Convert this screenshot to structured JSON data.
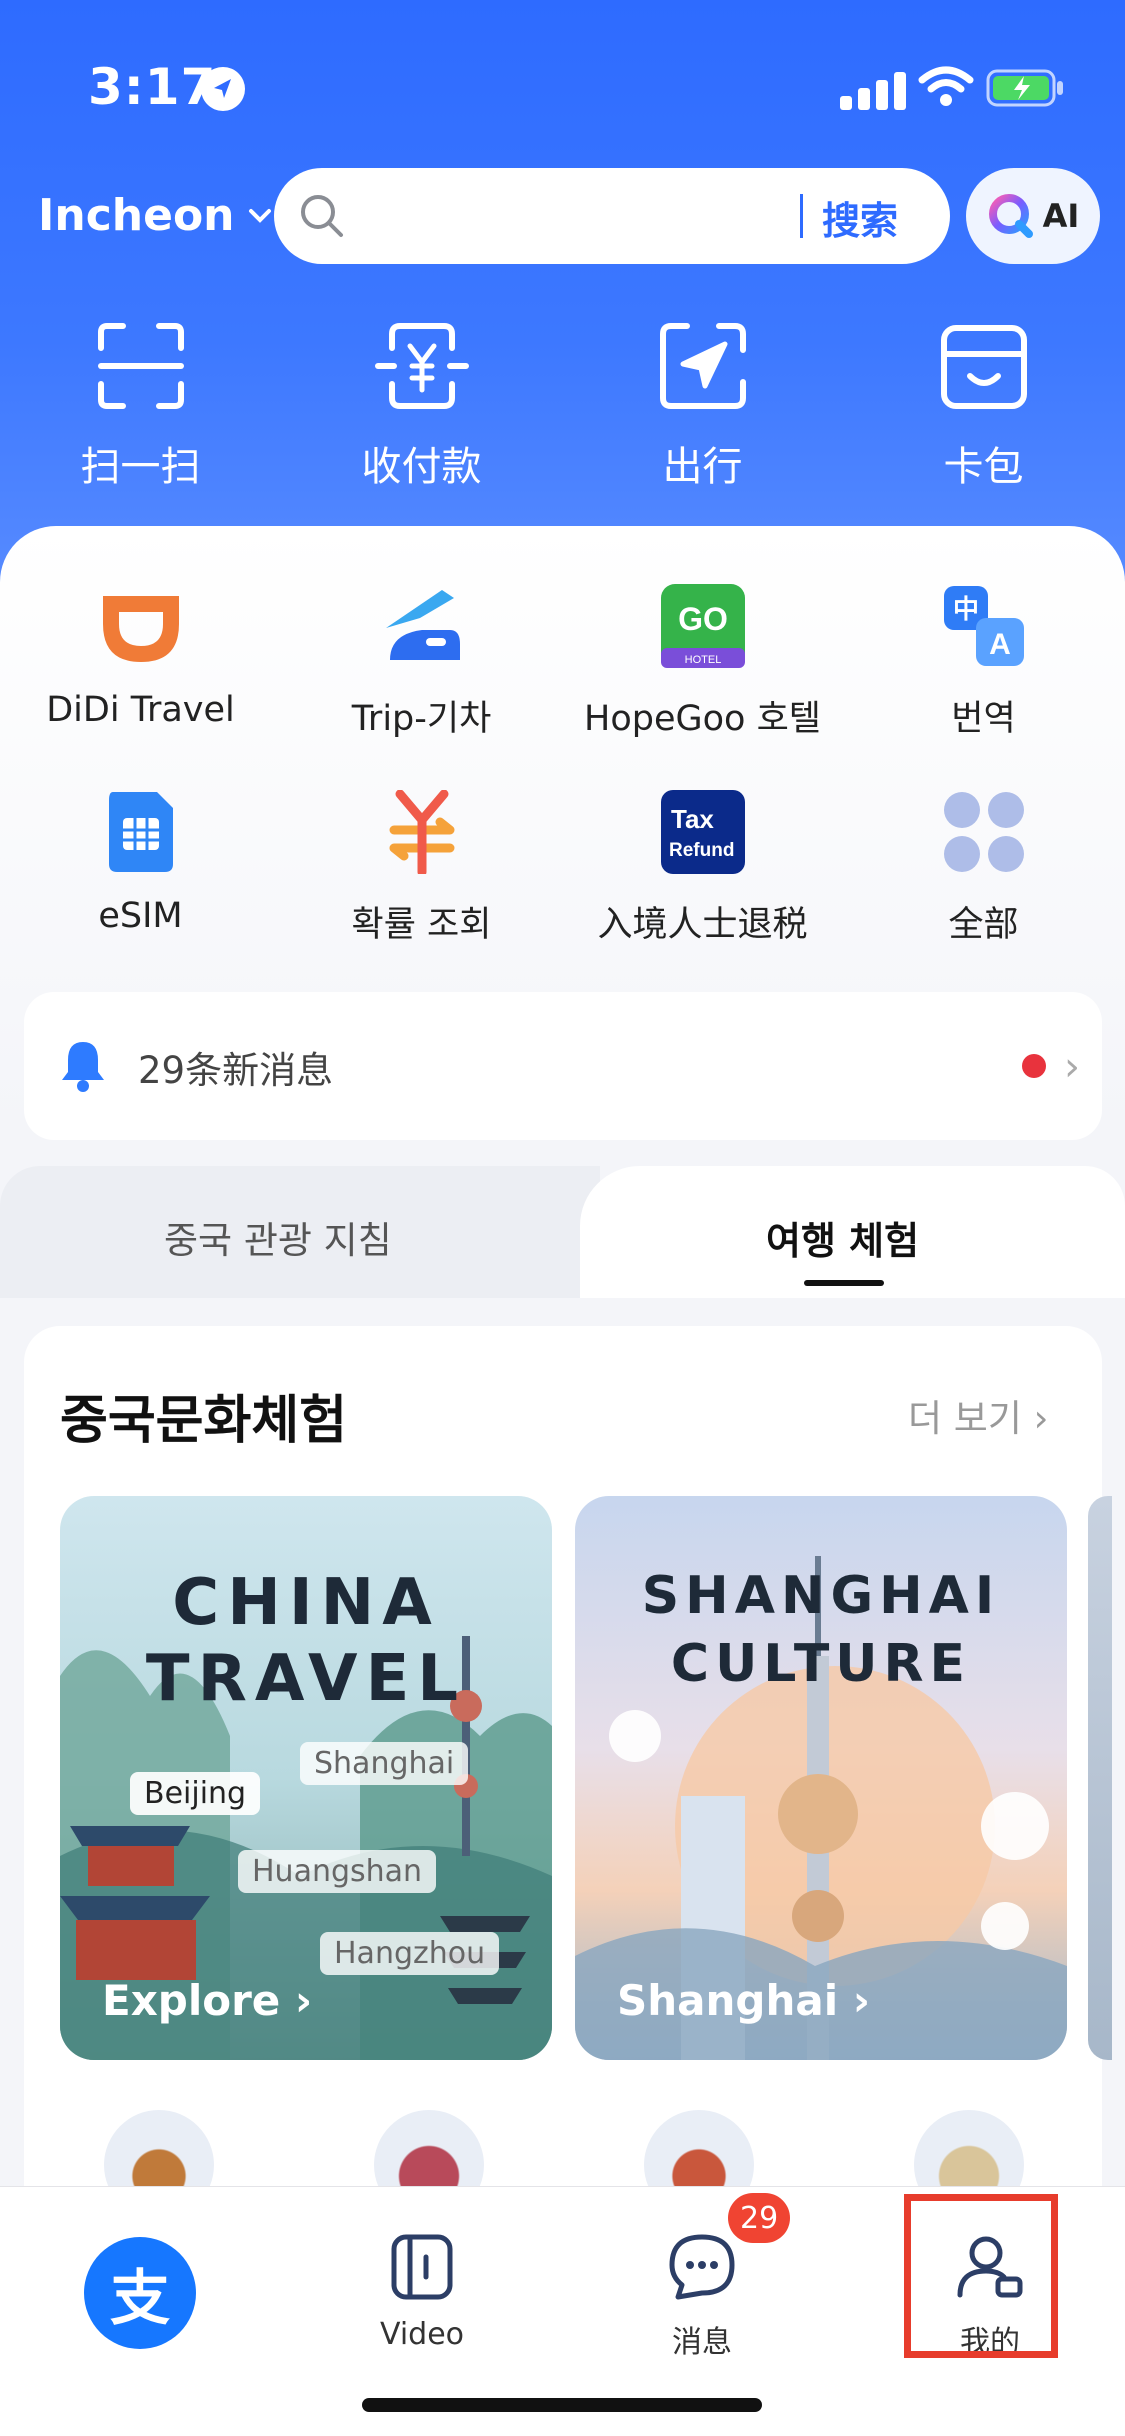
{
  "status_bar": {
    "time": "3:17"
  },
  "header": {
    "city": "Incheon",
    "search_placeholder": "",
    "search_button": "搜索",
    "ai_button": "AI"
  },
  "quick_actions": [
    {
      "label": "扫一扫",
      "icon": "scan-icon"
    },
    {
      "label": "收付款",
      "icon": "payment-icon"
    },
    {
      "label": "出行",
      "icon": "travel-icon"
    },
    {
      "label": "卡包",
      "icon": "wallet-icon"
    }
  ],
  "services": [
    {
      "label": "DiDi Travel",
      "icon": "didi-icon"
    },
    {
      "label": "Trip-기차",
      "icon": "train-icon"
    },
    {
      "label": "HopeGoo 호텔",
      "icon": "hopegoo-icon",
      "icon_text": "GO",
      "icon_sub": "HOTEL"
    },
    {
      "label": "번역",
      "icon": "translate-icon",
      "icon_text_a": "中",
      "icon_text_b": "A"
    },
    {
      "label": "eSIM",
      "icon": "esim-icon"
    },
    {
      "label": "확률 조회",
      "icon": "exchange-rate-icon"
    },
    {
      "label": "入境人士退税",
      "icon": "tax-refund-icon",
      "icon_text": "Tax",
      "icon_sub": "Refund"
    },
    {
      "label": "全部",
      "icon": "all-apps-icon"
    }
  ],
  "notice": {
    "text": "29条新消息"
  },
  "tabs": [
    {
      "label": "중국 관광 지침",
      "active": false
    },
    {
      "label": "여행 체험",
      "active": true
    }
  ],
  "section": {
    "title": "중국문화체험",
    "more": "더 보기",
    "cards": [
      {
        "line1": "CHINA",
        "line2": "TRAVEL",
        "tags": [
          "Beijing",
          "Shanghai",
          "Huangshan",
          "Hangzhou"
        ],
        "cta": "Explore"
      },
      {
        "line1": "SHANGHAI",
        "line2": "CULTURE",
        "cta": "Shanghai"
      }
    ]
  },
  "bottom_nav": {
    "home_glyph": "支",
    "video": "Video",
    "messages": "消息",
    "messages_badge": "29",
    "mine": "我的"
  },
  "colors": {
    "brand": "#1677ff",
    "header_blue": "#2e6bff",
    "badge_red": "#f04432",
    "highlight_red": "#e73c2c"
  }
}
